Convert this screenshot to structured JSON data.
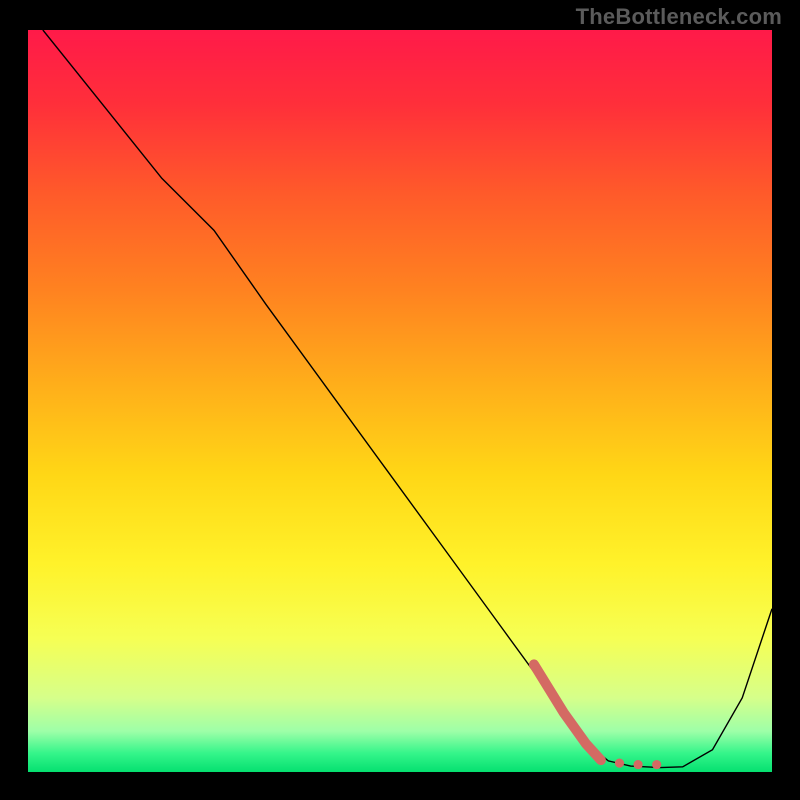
{
  "watermark": "TheBottleneck.com",
  "chart_data": {
    "type": "line",
    "title": "",
    "xlabel": "",
    "ylabel": "",
    "xlim": [
      0,
      100
    ],
    "ylim": [
      0,
      100
    ],
    "gradient_stops": [
      {
        "offset": 0.0,
        "color": "#ff1a49"
      },
      {
        "offset": 0.1,
        "color": "#ff2f3a"
      },
      {
        "offset": 0.22,
        "color": "#ff5a2a"
      },
      {
        "offset": 0.35,
        "color": "#ff8220"
      },
      {
        "offset": 0.48,
        "color": "#ffaf1a"
      },
      {
        "offset": 0.6,
        "color": "#ffd716"
      },
      {
        "offset": 0.72,
        "color": "#fff22a"
      },
      {
        "offset": 0.82,
        "color": "#f6ff54"
      },
      {
        "offset": 0.9,
        "color": "#d6ff8a"
      },
      {
        "offset": 0.945,
        "color": "#9effa8"
      },
      {
        "offset": 0.975,
        "color": "#34f58a"
      },
      {
        "offset": 1.0,
        "color": "#05e070"
      }
    ],
    "series": [
      {
        "name": "bottleneck-curve",
        "type": "line",
        "color": "#000000",
        "width": 1.4,
        "x": [
          2,
          10,
          18,
          25,
          32,
          40,
          48,
          56,
          64,
          72,
          75,
          78,
          81,
          85,
          88,
          92,
          96,
          100
        ],
        "y": [
          100,
          90,
          80,
          73,
          63,
          52,
          41,
          30,
          19,
          8,
          4,
          1.5,
          0.8,
          0.6,
          0.7,
          3,
          10,
          22
        ]
      },
      {
        "name": "optimal-range-marker",
        "type": "line",
        "color": "#d46a63",
        "width": 10,
        "linecap": "round",
        "dash": null,
        "x": [
          68,
          72,
          75,
          77
        ],
        "y": [
          14.5,
          8,
          3.8,
          1.6
        ]
      },
      {
        "name": "optimal-range-dots",
        "type": "scatter",
        "color": "#d46a63",
        "radius": 4.6,
        "x": [
          79.5,
          82,
          84.5
        ],
        "y": [
          1.2,
          1.0,
          1.0
        ]
      }
    ]
  }
}
